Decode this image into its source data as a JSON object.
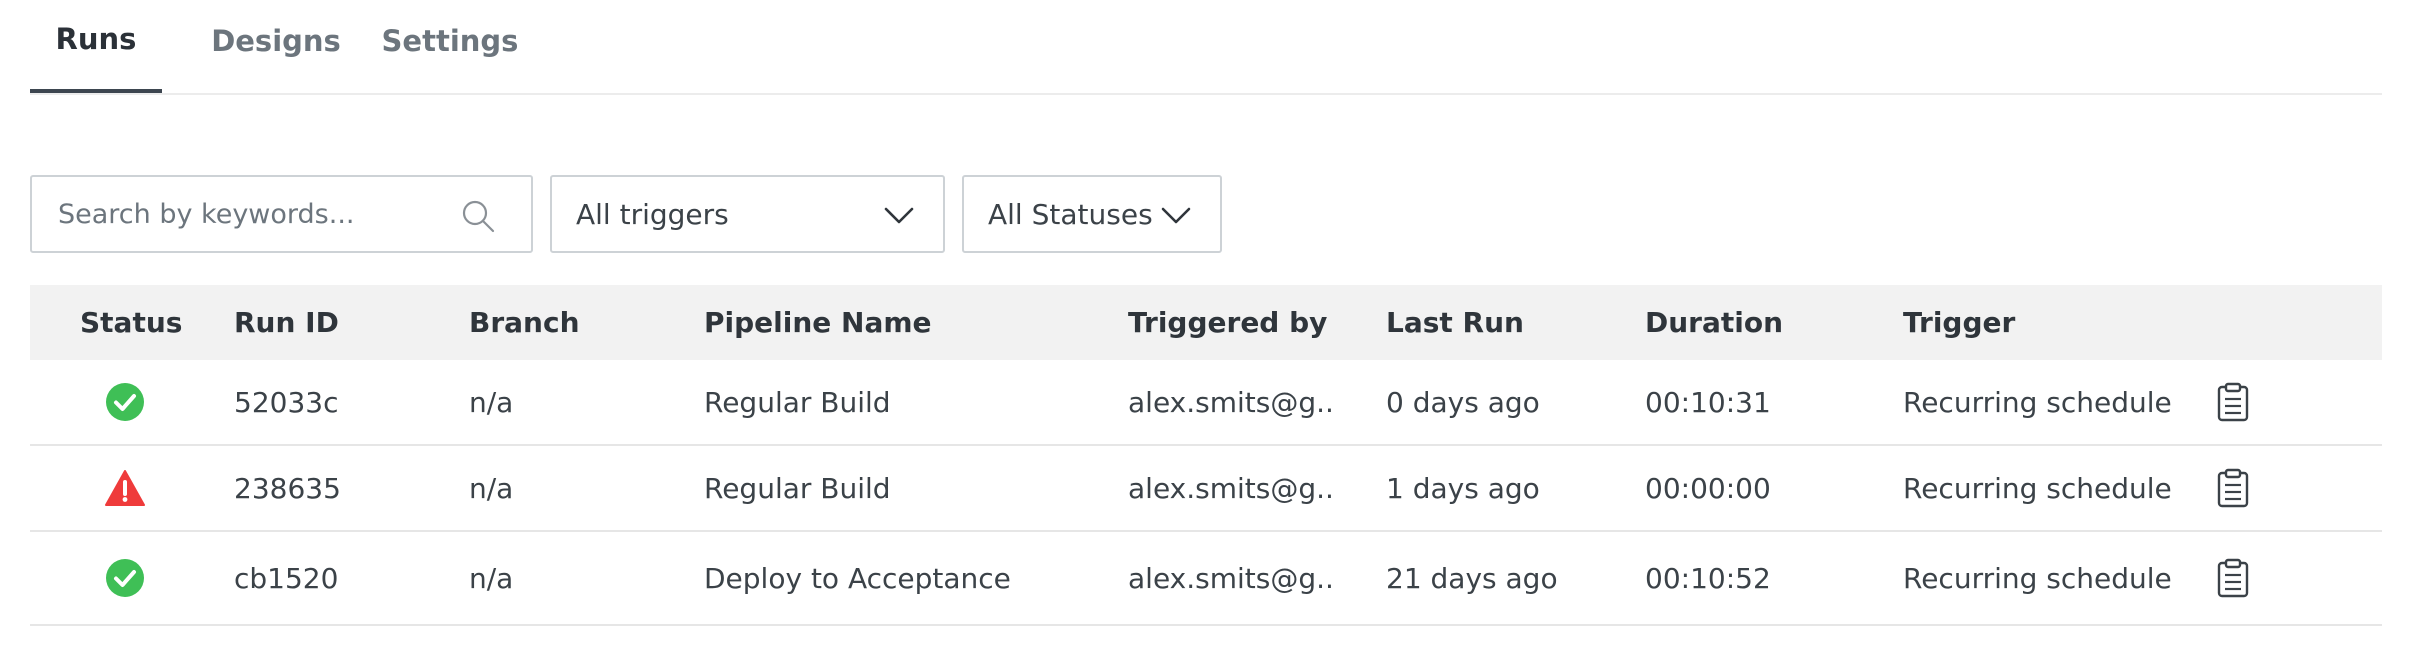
{
  "tabs": [
    {
      "label": "Runs",
      "active": true
    },
    {
      "label": "Designs",
      "active": false
    },
    {
      "label": "Settings",
      "active": false
    }
  ],
  "filters": {
    "search_placeholder": "Search by keywords...",
    "triggers_selected": "All triggers",
    "statuses_selected": "All Statuses"
  },
  "table": {
    "headers": {
      "status": "Status",
      "run_id": "Run ID",
      "branch": "Branch",
      "pipeline": "Pipeline Name",
      "triggered_by": "Triggered by",
      "last_run": "Last Run",
      "duration": "Duration",
      "trigger": "Trigger"
    },
    "rows": [
      {
        "status": "success",
        "run_id": "52033c",
        "branch": "n/a",
        "pipeline": "Regular Build",
        "triggered_by": "alex.smits@g..",
        "last_run": "0 days ago",
        "duration": "00:10:31",
        "trigger": "Recurring schedule"
      },
      {
        "status": "warning",
        "run_id": "238635",
        "branch": "n/a",
        "pipeline": "Regular Build",
        "triggered_by": "alex.smits@g..",
        "last_run": "1 days ago",
        "duration": "00:00:00",
        "trigger": "Recurring schedule"
      },
      {
        "status": "success",
        "run_id": "cb1520",
        "branch": "n/a",
        "pipeline": "Deploy to Acceptance",
        "triggered_by": "alex.smits@g..",
        "last_run": "21 days ago",
        "duration": "00:10:52",
        "trigger": "Recurring schedule"
      }
    ]
  },
  "colors": {
    "success": "#3fbf56",
    "warning": "#ef3b3b"
  },
  "icons": {
    "search": "search-icon",
    "chevron": "chevron-down-icon",
    "success": "check-circle-icon",
    "warning": "warning-triangle-icon",
    "action": "clipboard-icon"
  }
}
